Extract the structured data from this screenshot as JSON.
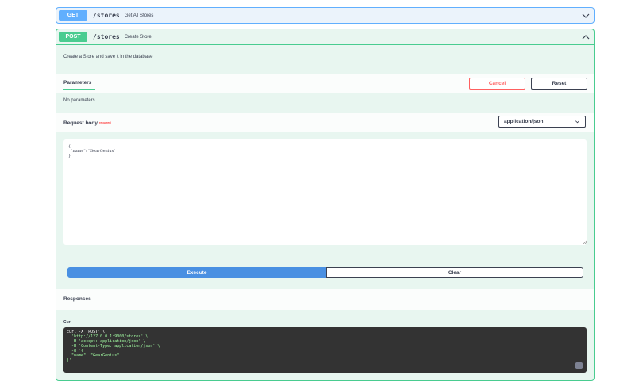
{
  "get_op": {
    "method": "GET",
    "path": "/stores",
    "summary": "Get All Stores"
  },
  "post_op": {
    "method": "POST",
    "path": "/stores",
    "summary": "Create Store",
    "description": "Create a Store and save it in the database",
    "parameters": {
      "tab_label": "Parameters",
      "cancel_label": "Cancel",
      "reset_label": "Reset",
      "empty_text": "No parameters"
    },
    "request_body": {
      "title": "Request body",
      "required_label": "required",
      "content_type": "application/json",
      "body": "{\n  \"name\": \"GearGenius\"\n}"
    },
    "execute_label": "Execute",
    "clear_label": "Clear",
    "responses": {
      "title": "Responses",
      "curl_label": "Curl",
      "curl_lines": [
        "curl -X 'POST' \\",
        "  'http://127.0.0.1:9000/stores' \\",
        "  -H 'accept: application/json' \\",
        "  -H 'Content-Type: application/json' \\",
        "  -d '{",
        "  \"name\": \"GearGenius\"",
        "}'"
      ]
    }
  },
  "colors": {
    "get": "#61affe",
    "post": "#49cc90",
    "cancel": "#ff6060",
    "execute": "#4990e2",
    "curl_bg": "#333333"
  }
}
